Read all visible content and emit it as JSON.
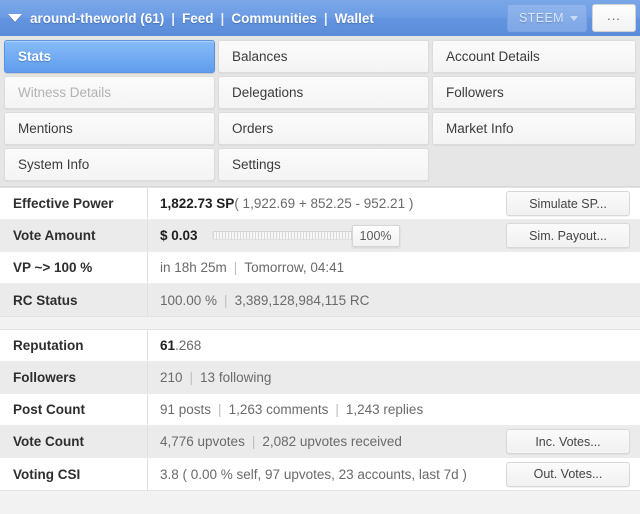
{
  "header": {
    "caret_icon": "triangle-down-icon",
    "account": "around-theworld (61)",
    "sep": "|",
    "nav": [
      "Feed",
      "Communities",
      "Wallet"
    ],
    "chain_label": "STEEM",
    "chain_caret_icon": "caret-down-icon",
    "more_label": "...",
    "brand_color": "#6294e0"
  },
  "tabs": [
    {
      "label": "Stats",
      "state": "active"
    },
    {
      "label": "Balances",
      "state": "normal"
    },
    {
      "label": "Account Details",
      "state": "normal"
    },
    {
      "label": "Witness Details",
      "state": "disabled"
    },
    {
      "label": "Delegations",
      "state": "normal"
    },
    {
      "label": "Followers",
      "state": "normal"
    },
    {
      "label": "Mentions",
      "state": "normal"
    },
    {
      "label": "Orders",
      "state": "normal"
    },
    {
      "label": "Market Info",
      "state": "normal"
    },
    {
      "label": "System Info",
      "state": "normal"
    },
    {
      "label": "Settings",
      "state": "normal"
    },
    {
      "label": "",
      "state": "empty"
    }
  ],
  "group1": [
    {
      "label": "Effective Power",
      "value_strong": "1,822.73 SP",
      "value_rest": "( 1,922.69 + 852.25 - 952.21 )",
      "action": "Simulate SP..."
    },
    {
      "label": "Vote Amount",
      "value_strong": "$ 0.03",
      "slider_value": "100%",
      "slider_percent": 100,
      "action": "Sim. Payout..."
    },
    {
      "label": "VP ~> 100 %",
      "part1": "in 18h 25m",
      "part2": "Tomorrow, 04:41",
      "action": ""
    },
    {
      "label": "RC Status",
      "part1": "100.00 %",
      "part2": "3,389,128,984,115 RC",
      "action": ""
    }
  ],
  "group2": [
    {
      "label": "Reputation",
      "value_strong": "61",
      "value_rest": ".268",
      "action": ""
    },
    {
      "label": "Followers",
      "part1": "210",
      "part2": "13 following",
      "action": ""
    },
    {
      "label": "Post Count",
      "part1": "91 posts",
      "part2": "1,263 comments",
      "part3": "1,243 replies",
      "action": ""
    },
    {
      "label": "Vote Count",
      "part1": "4,776 upvotes",
      "part2": "2,082 upvotes received",
      "action": "Inc. Votes..."
    },
    {
      "label": "Voting CSI",
      "value_rest": "3.8 ( 0.00 % self, 97 upvotes, 23 accounts, last 7d )",
      "action": "Out. Votes..."
    }
  ]
}
